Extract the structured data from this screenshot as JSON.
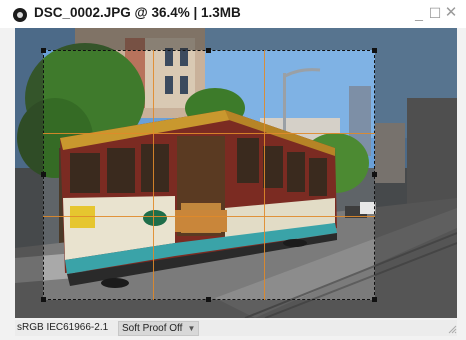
{
  "window": {
    "title": "DSC_0002.JPG @ 36.4% | 1.3MB",
    "app_icon": "camera-lens-icon",
    "controls": {
      "minimize": "_",
      "maximize": "☐",
      "close": "✕"
    }
  },
  "canvas": {
    "crop_active": true,
    "guides": "rule-of-thirds",
    "guide_color": "#e08a2a"
  },
  "statusbar": {
    "color_profile": "sRGB IEC61966-2.1",
    "soft_proof": "Soft Proof Off",
    "soft_proof_arrow": "▼"
  }
}
